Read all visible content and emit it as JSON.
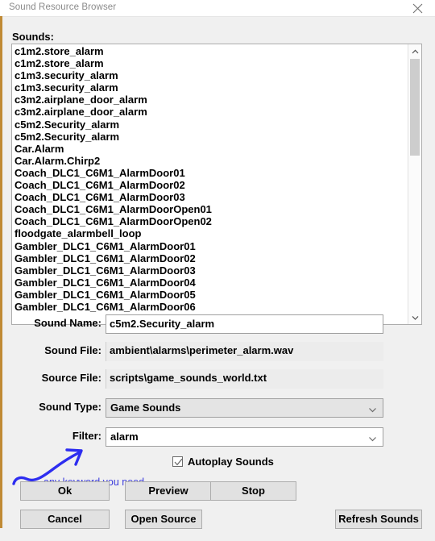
{
  "window": {
    "title": "Sound Resource Browser",
    "close_icon": "close-icon",
    "accent_color": "#c08a35"
  },
  "sounds_panel": {
    "label": "Sounds:",
    "items": [
      "c1m2.store_alarm",
      "c1m2.store_alarm",
      "c1m3.security_alarm",
      "c1m3.security_alarm",
      "c3m2.airplane_door_alarm",
      "c3m2.airplane_door_alarm",
      "c5m2.Security_alarm",
      "c5m2.Security_alarm",
      "Car.Alarm",
      "Car.Alarm.Chirp2",
      "Coach_DLC1_C6M1_AlarmDoor01",
      "Coach_DLC1_C6M1_AlarmDoor02",
      "Coach_DLC1_C6M1_AlarmDoor03",
      "Coach_DLC1_C6M1_AlarmDoorOpen01",
      "Coach_DLC1_C6M1_AlarmDoorOpen02",
      "floodgate_alarmbell_loop",
      "Gambler_DLC1_C6M1_AlarmDoor01",
      "Gambler_DLC1_C6M1_AlarmDoor02",
      "Gambler_DLC1_C6M1_AlarmDoor03",
      "Gambler_DLC1_C6M1_AlarmDoor04",
      "Gambler_DLC1_C6M1_AlarmDoor05",
      "Gambler_DLC1_C6M1_AlarmDoor06"
    ],
    "scrollbar": {
      "up_icon": "chevron-up-icon",
      "down_icon": "chevron-down-icon"
    }
  },
  "form": {
    "sound_name": {
      "label": "Sound Name:",
      "value": "c5m2.Security_alarm"
    },
    "sound_file": {
      "label": "Sound File:",
      "value": "ambient\\alarms\\perimeter_alarm.wav"
    },
    "source_file": {
      "label": "Source File:",
      "value": "scripts\\game_sounds_world.txt"
    },
    "sound_type": {
      "label": "Sound Type:",
      "value": "Game Sounds",
      "arrow_icon": "chevron-down-icon"
    },
    "filter": {
      "label": "Filter:",
      "value": "alarm",
      "arrow_icon": "chevron-down-icon"
    },
    "autoplay": {
      "label": "Autoplay Sounds",
      "checked": true,
      "check_icon": "check-icon"
    }
  },
  "buttons": {
    "ok": "Ok",
    "preview": "Preview",
    "stop": "Stop",
    "cancel": "Cancel",
    "open_source": "Open Source",
    "refresh_sounds": "Refresh Sounds"
  },
  "annotation": {
    "text": "any keyword you need",
    "color": "#2d2df0",
    "icon": "hand-drawn-arrow-icon"
  }
}
